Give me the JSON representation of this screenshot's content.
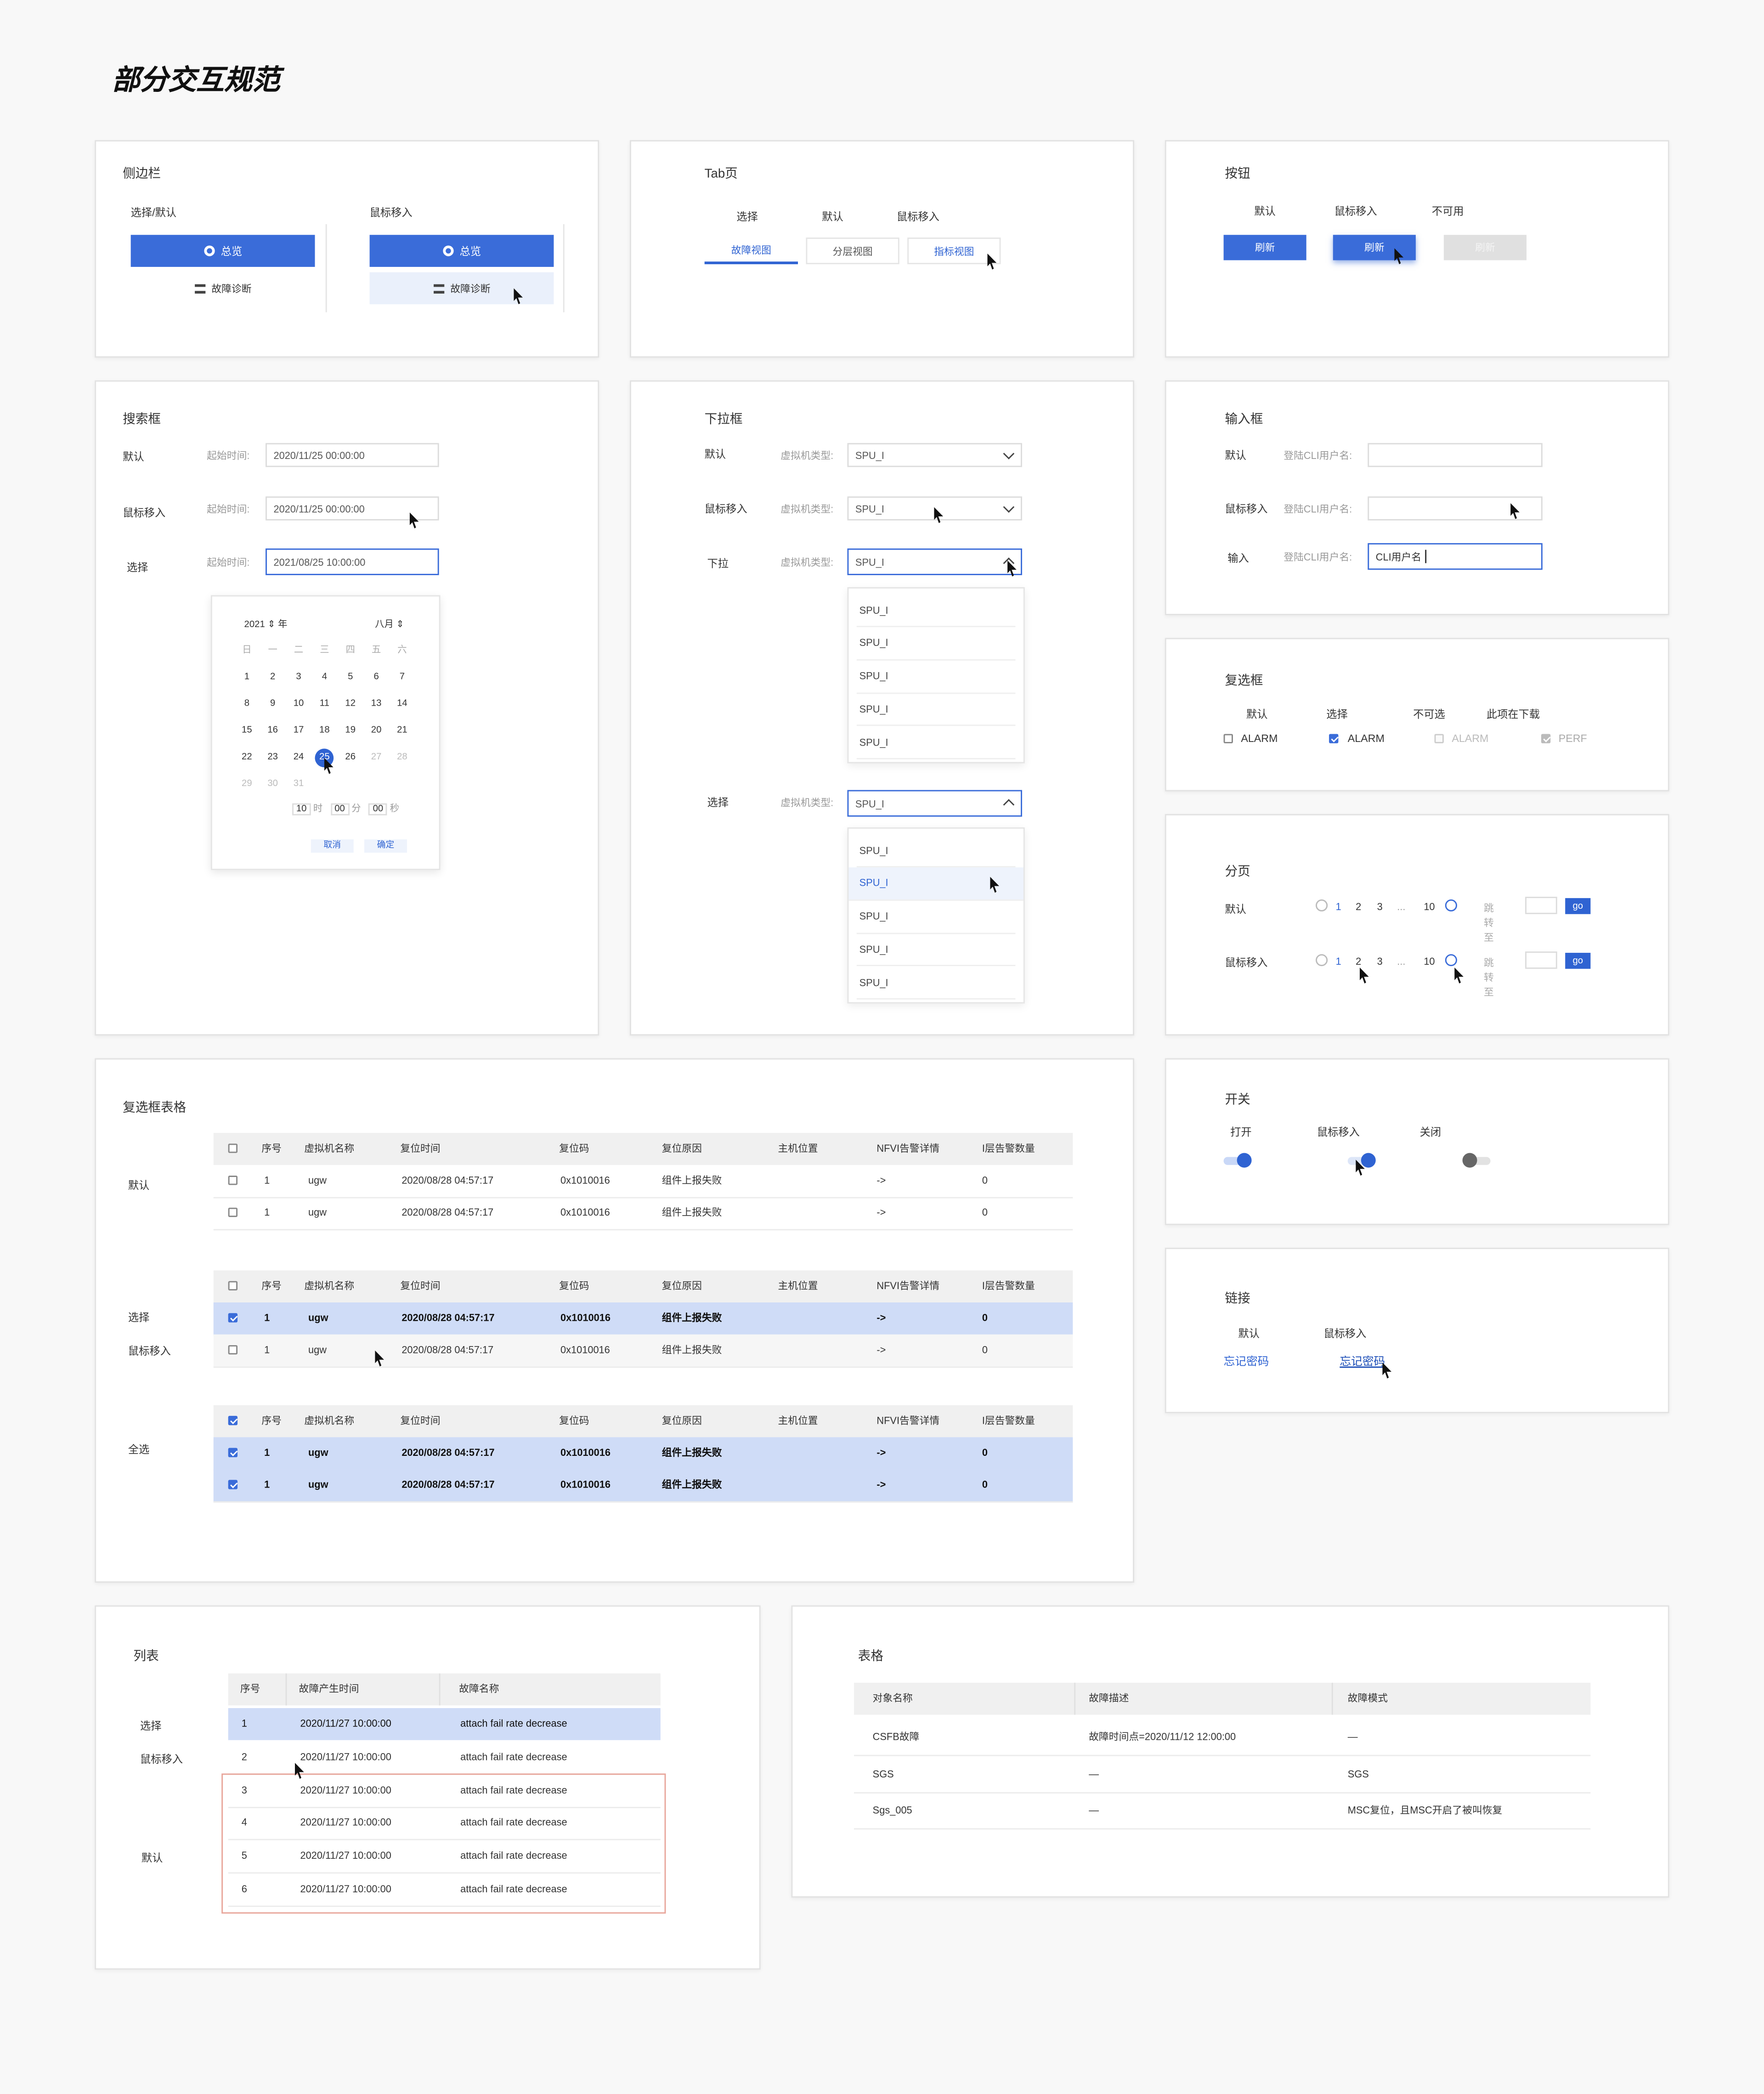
{
  "page_title": "部分交互规范",
  "sidebar": {
    "title": "侧边栏",
    "col_default": "选择/默认",
    "col_hover": "鼠标移入",
    "item_overview": "总览",
    "item_diag": "故障诊断"
  },
  "tabs": {
    "title": "Tab页",
    "col_select": "选择",
    "col_default": "默认",
    "col_hover": "鼠标移入",
    "tab1": "故障视图",
    "tab2": "分层视图",
    "tab3": "指标视图"
  },
  "buttons": {
    "title": "按钮",
    "col_default": "默认",
    "col_hover": "鼠标移入",
    "col_disabled": "不可用",
    "label": "刷新"
  },
  "search": {
    "title": "搜索框",
    "row_default": "默认",
    "row_hover": "鼠标移入",
    "row_select": "选择",
    "field_label": "起始时间:",
    "value_default": "2020/11/25 00:00:00",
    "value_hover": "2020/11/25 00:00:00",
    "value_select": "2021/08/25 10:00:00"
  },
  "calendar": {
    "year": "2021",
    "year_suffix": "年",
    "month": "八月",
    "weekdays": [
      "日",
      "一",
      "二",
      "三",
      "四",
      "五",
      "六"
    ],
    "weeks": [
      [
        "",
        "",
        "",
        "",
        "",
        "",
        ""
      ],
      [
        "1",
        "2",
        "3",
        "4",
        "5",
        "6",
        "7"
      ],
      [
        "8",
        "9",
        "10",
        "11",
        "12",
        "13",
        "14"
      ],
      [
        "15",
        "16",
        "17",
        "18",
        "19",
        "20",
        "21"
      ],
      [
        "22",
        "23",
        "24",
        "25",
        "26",
        "27",
        "28"
      ],
      [
        "29",
        "30",
        "31",
        "",
        "",
        "",
        ""
      ]
    ],
    "selected_day": "25",
    "hour": "10",
    "hour_unit": "时",
    "minute": "00",
    "minute_unit": "分",
    "second": "00",
    "second_unit": "秒",
    "cancel": "取消",
    "confirm": "确定"
  },
  "dropdown": {
    "title": "下拉框",
    "row_default": "默认",
    "row_hover": "鼠标移入",
    "row_open": "下拉",
    "row_select": "选择",
    "field_label": "虚拟机类型:",
    "value": "SPU_I",
    "options": [
      "SPU_I",
      "SPU_I",
      "SPU_I",
      "SPU_I",
      "SPU_I"
    ]
  },
  "input": {
    "title": "输入框",
    "row_default": "默认",
    "row_hover": "鼠标移入",
    "row_typing": "输入",
    "field_label": "登陆CLI用户名:",
    "typed_value": "CLI用户名"
  },
  "checkbox": {
    "title": "复选框",
    "col_default": "默认",
    "col_select": "选择",
    "col_disabled": "不可选",
    "col_partial": "此项在下载",
    "label_alarm": "ALARM",
    "label_perf": "PERF"
  },
  "pagination": {
    "title": "分页",
    "row_default": "默认",
    "row_hover": "鼠标移入",
    "pages": [
      "1",
      "2",
      "3",
      "...",
      "10"
    ],
    "jump_label": "跳转至",
    "go": "go"
  },
  "switch": {
    "title": "开关",
    "col_on": "打开",
    "col_hover": "鼠标移入",
    "col_off": "关闭",
    "colors": {
      "on": "#2f63d2",
      "off": "#666666"
    }
  },
  "link": {
    "title": "链接",
    "col_default": "默认",
    "col_hover": "鼠标移入",
    "text": "忘记密码"
  },
  "cbtable": {
    "title": "复选框表格",
    "row_default": "默认",
    "row_select": "选择",
    "row_hover": "鼠标移入",
    "row_all": "全选",
    "headers": [
      "序号",
      "虚拟机名称",
      "复位时间",
      "复位码",
      "复位原因",
      "主机位置",
      "NFVI告警详情",
      "I层告警数量"
    ],
    "row": [
      "1",
      "ugw",
      "2020/08/28 04:57:17",
      "0x1010016",
      "组件上报失败",
      "",
      "->",
      "0"
    ]
  },
  "list": {
    "title": "列表",
    "row_select": "选择",
    "row_hover": "鼠标移入",
    "row_default": "默认",
    "headers": [
      "序号",
      "故障产生时间",
      "故障名称"
    ],
    "rows": [
      [
        "1",
        "2020/11/27 10:00:00",
        "attach fail rate decrease"
      ],
      [
        "2",
        "2020/11/27 10:00:00",
        "attach fail rate decrease"
      ],
      [
        "3",
        "2020/11/27 10:00:00",
        "attach fail rate decrease"
      ],
      [
        "4",
        "2020/11/27 10:00:00",
        "attach fail rate decrease"
      ],
      [
        "5",
        "2020/11/27 10:00:00",
        "attach fail rate decrease"
      ],
      [
        "6",
        "2020/11/27 10:00:00",
        "attach fail rate decrease"
      ]
    ]
  },
  "table": {
    "title": "表格",
    "headers": [
      "对象名称",
      "故障描述",
      "故障模式"
    ],
    "rows": [
      [
        "CSFB故障",
        "故障时间点=2020/11/12 12:00:00",
        "—"
      ],
      [
        "SGS",
        "—",
        "SGS"
      ],
      [
        "Sgs_005",
        "—",
        "MSC复位，且MSC开启了被叫恢复"
      ]
    ]
  },
  "colors": {
    "primary": "#3a6cd9",
    "selected_row": "#cfdcf7",
    "highlight_border": "#e8a59a",
    "page_bg": "#f8f8f8"
  }
}
